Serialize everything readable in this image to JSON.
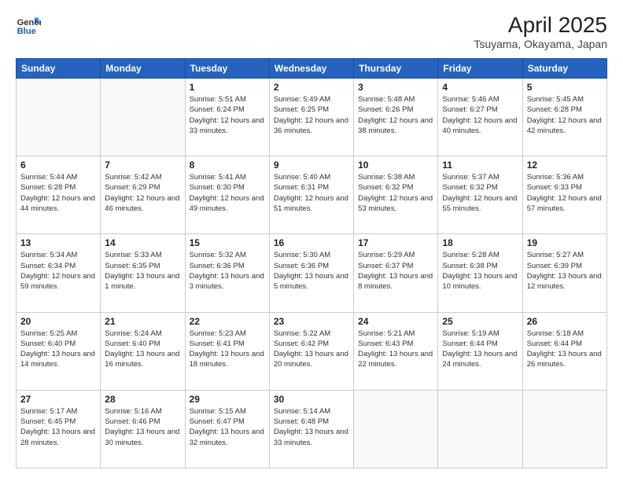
{
  "header": {
    "logo_line1": "General",
    "logo_line2": "Blue",
    "month": "April 2025",
    "location": "Tsuyama, Okayama, Japan"
  },
  "weekdays": [
    "Sunday",
    "Monday",
    "Tuesday",
    "Wednesday",
    "Thursday",
    "Friday",
    "Saturday"
  ],
  "weeks": [
    [
      {
        "day": "",
        "info": ""
      },
      {
        "day": "",
        "info": ""
      },
      {
        "day": "1",
        "info": "Sunrise: 5:51 AM\nSunset: 6:24 PM\nDaylight: 12 hours and 33 minutes."
      },
      {
        "day": "2",
        "info": "Sunrise: 5:49 AM\nSunset: 6:25 PM\nDaylight: 12 hours and 36 minutes."
      },
      {
        "day": "3",
        "info": "Sunrise: 5:48 AM\nSunset: 6:26 PM\nDaylight: 12 hours and 38 minutes."
      },
      {
        "day": "4",
        "info": "Sunrise: 5:46 AM\nSunset: 6:27 PM\nDaylight: 12 hours and 40 minutes."
      },
      {
        "day": "5",
        "info": "Sunrise: 5:45 AM\nSunset: 6:28 PM\nDaylight: 12 hours and 42 minutes."
      }
    ],
    [
      {
        "day": "6",
        "info": "Sunrise: 5:44 AM\nSunset: 6:28 PM\nDaylight: 12 hours and 44 minutes."
      },
      {
        "day": "7",
        "info": "Sunrise: 5:42 AM\nSunset: 6:29 PM\nDaylight: 12 hours and 46 minutes."
      },
      {
        "day": "8",
        "info": "Sunrise: 5:41 AM\nSunset: 6:30 PM\nDaylight: 12 hours and 49 minutes."
      },
      {
        "day": "9",
        "info": "Sunrise: 5:40 AM\nSunset: 6:31 PM\nDaylight: 12 hours and 51 minutes."
      },
      {
        "day": "10",
        "info": "Sunrise: 5:38 AM\nSunset: 6:32 PM\nDaylight: 12 hours and 53 minutes."
      },
      {
        "day": "11",
        "info": "Sunrise: 5:37 AM\nSunset: 6:32 PM\nDaylight: 12 hours and 55 minutes."
      },
      {
        "day": "12",
        "info": "Sunrise: 5:36 AM\nSunset: 6:33 PM\nDaylight: 12 hours and 57 minutes."
      }
    ],
    [
      {
        "day": "13",
        "info": "Sunrise: 5:34 AM\nSunset: 6:34 PM\nDaylight: 12 hours and 59 minutes."
      },
      {
        "day": "14",
        "info": "Sunrise: 5:33 AM\nSunset: 6:35 PM\nDaylight: 13 hours and 1 minute."
      },
      {
        "day": "15",
        "info": "Sunrise: 5:32 AM\nSunset: 6:36 PM\nDaylight: 13 hours and 3 minutes."
      },
      {
        "day": "16",
        "info": "Sunrise: 5:30 AM\nSunset: 6:36 PM\nDaylight: 13 hours and 5 minutes."
      },
      {
        "day": "17",
        "info": "Sunrise: 5:29 AM\nSunset: 6:37 PM\nDaylight: 13 hours and 8 minutes."
      },
      {
        "day": "18",
        "info": "Sunrise: 5:28 AM\nSunset: 6:38 PM\nDaylight: 13 hours and 10 minutes."
      },
      {
        "day": "19",
        "info": "Sunrise: 5:27 AM\nSunset: 6:39 PM\nDaylight: 13 hours and 12 minutes."
      }
    ],
    [
      {
        "day": "20",
        "info": "Sunrise: 5:25 AM\nSunset: 6:40 PM\nDaylight: 13 hours and 14 minutes."
      },
      {
        "day": "21",
        "info": "Sunrise: 5:24 AM\nSunset: 6:40 PM\nDaylight: 13 hours and 16 minutes."
      },
      {
        "day": "22",
        "info": "Sunrise: 5:23 AM\nSunset: 6:41 PM\nDaylight: 13 hours and 18 minutes."
      },
      {
        "day": "23",
        "info": "Sunrise: 5:22 AM\nSunset: 6:42 PM\nDaylight: 13 hours and 20 minutes."
      },
      {
        "day": "24",
        "info": "Sunrise: 5:21 AM\nSunset: 6:43 PM\nDaylight: 13 hours and 22 minutes."
      },
      {
        "day": "25",
        "info": "Sunrise: 5:19 AM\nSunset: 6:44 PM\nDaylight: 13 hours and 24 minutes."
      },
      {
        "day": "26",
        "info": "Sunrise: 5:18 AM\nSunset: 6:44 PM\nDaylight: 13 hours and 26 minutes."
      }
    ],
    [
      {
        "day": "27",
        "info": "Sunrise: 5:17 AM\nSunset: 6:45 PM\nDaylight: 13 hours and 28 minutes."
      },
      {
        "day": "28",
        "info": "Sunrise: 5:16 AM\nSunset: 6:46 PM\nDaylight: 13 hours and 30 minutes."
      },
      {
        "day": "29",
        "info": "Sunrise: 5:15 AM\nSunset: 6:47 PM\nDaylight: 13 hours and 32 minutes."
      },
      {
        "day": "30",
        "info": "Sunrise: 5:14 AM\nSunset: 6:48 PM\nDaylight: 13 hours and 33 minutes."
      },
      {
        "day": "",
        "info": ""
      },
      {
        "day": "",
        "info": ""
      },
      {
        "day": "",
        "info": ""
      }
    ]
  ]
}
